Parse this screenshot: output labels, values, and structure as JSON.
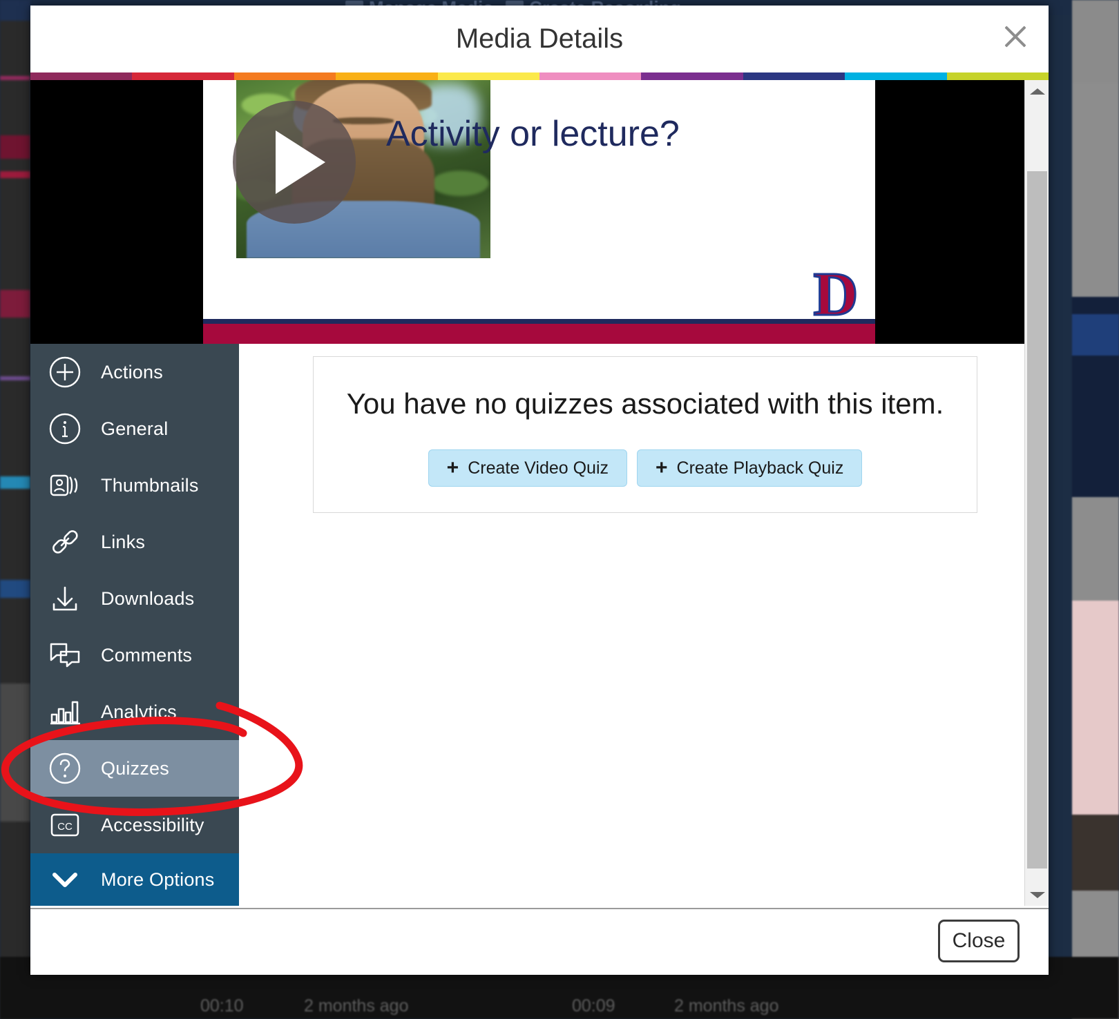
{
  "background": {
    "topbar_items": [
      {
        "label": "Manage Media",
        "icon": "video-icon"
      },
      {
        "label": "Create Recording",
        "icon": "record-icon"
      }
    ],
    "bottom_row_texts": [
      "00:10",
      "2 months ago",
      "00:09",
      "2 months ago"
    ]
  },
  "modal": {
    "title": "Media Details",
    "close_icon": "close-icon",
    "accent_bar_colors": [
      "#8f2a5c",
      "#d62839",
      "#f47b20",
      "#f9b016",
      "#fbe94b",
      "#ef8ec0",
      "#7b2f8f",
      "#2c3782",
      "#00b1e2",
      "#c6d32a"
    ],
    "footer": {
      "close_label": "Close"
    }
  },
  "player": {
    "slide_title": "Activity or lecture?",
    "play_icon": "play-icon",
    "logo_glyph": "D",
    "logo_name": "detroit-mercy-d-logo"
  },
  "scrollbar": {
    "up_arrow": "chevron-up-icon",
    "down_arrow": "chevron-down-icon",
    "thumb": "scroll-thumb"
  },
  "sidebar": {
    "items": [
      {
        "label": "Actions",
        "icon": "plus-circle-icon",
        "active": false
      },
      {
        "label": "General",
        "icon": "info-circle-icon",
        "active": false
      },
      {
        "label": "Thumbnails",
        "icon": "thumbnails-icon",
        "active": false
      },
      {
        "label": "Links",
        "icon": "link-icon",
        "active": false
      },
      {
        "label": "Downloads",
        "icon": "download-icon",
        "active": false
      },
      {
        "label": "Comments",
        "icon": "comments-icon",
        "active": false
      },
      {
        "label": "Analytics",
        "icon": "bar-chart-icon",
        "active": false
      },
      {
        "label": "Quizzes",
        "icon": "question-circle-icon",
        "active": true
      },
      {
        "label": "Accessibility",
        "icon": "closed-caption-icon",
        "active": false
      }
    ],
    "more_options": {
      "label": "More Options",
      "icon": "chevron-down-icon"
    },
    "active_bg": "#7d8fa1",
    "bg": "#3a4852",
    "more_bg": "#0d5c8c"
  },
  "content": {
    "empty_message": "You have no quizzes associated with this item.",
    "buttons": [
      {
        "label": "Create Video Quiz",
        "icon": "plus-icon"
      },
      {
        "label": "Create Playback Quiz",
        "icon": "plus-icon"
      }
    ],
    "button_bg": "#c3e7f8"
  },
  "annotation": {
    "shape": "ellipse",
    "color": "#e8131a",
    "target": "Quizzes"
  }
}
